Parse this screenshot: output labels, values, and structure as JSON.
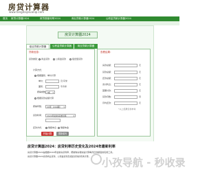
{
  "site": {
    "logo_text": "房贷计算器",
    "url": "www.fangdaijisuanqi.com"
  },
  "nav": {
    "items": [
      "首页",
      "房贷计算器2024",
      "房贷首套利率2024",
      "商业贷款计算器2024",
      "公积金贷款计算器2024"
    ]
  },
  "calculator": {
    "title": "房贷计算器2024",
    "tabs": [
      "组合贷款计算器",
      "公积金贷款计算器",
      "商业贷款计算器"
    ],
    "form": {
      "section_title": "贷款信息：",
      "calc_method_label": "贷款类别：",
      "calc_method_options": [
        "商业贷款",
        "公积金贷款",
        "组合型贷款"
      ],
      "calc_type_label": "计算方式：",
      "by_area_label": "根据面积、单价计算",
      "unit_price_label": "单价：",
      "unit_price_unit": "元/平米",
      "area_label": "面积：",
      "area_unit": "平方米",
      "ratio_label": "按揭成数：",
      "ratio_value": "7成",
      "by_total_label": "根据贷款总额计算",
      "term_label": "按揭年数：",
      "term_value": "20年（240期）",
      "rate_label": "贷款利率：",
      "rate_value": "2024年最新基准利率",
      "repay_label": "还款方式：",
      "repay_options": [
        "等额本息",
        "等额本金"
      ],
      "calc_button": "开始计算",
      "reset_button": "重新填写"
    },
    "result": {
      "section_title": "查看结果：",
      "rows": [
        {
          "label": "房款总额：",
          "unit": "元"
        },
        {
          "label": "贷款总额：",
          "unit": "元"
        },
        {
          "label": "还款总额：",
          "unit": "元"
        },
        {
          "label": "支付利息：",
          "unit": "元"
        },
        {
          "label": "首期付款：",
          "unit": "元"
        },
        {
          "label": "贷款月数：",
          "unit": "月"
        },
        {
          "label": "月均还款：",
          "unit": "元"
        }
      ],
      "note": "*以上结果仅供参考"
    }
  },
  "article": {
    "title": "房贷计算器2024：房贷利率历史变化及2024年最新利率",
    "paragraphs": [
      "房贷计算器2024是根据2024年最新房贷利率，帮助购房者快速计算每月还款额度的实用工具。",
      "房贷计算器2024支持商业贷款、公积金贷款及组合贷款的月供计算。"
    ]
  },
  "watermark": {
    "text": "小孜导航 - 秒收录"
  },
  "colors": {
    "nav_green": "#2f8a30",
    "accent_red": "#c33",
    "panel_bg": "#f4faf4"
  }
}
